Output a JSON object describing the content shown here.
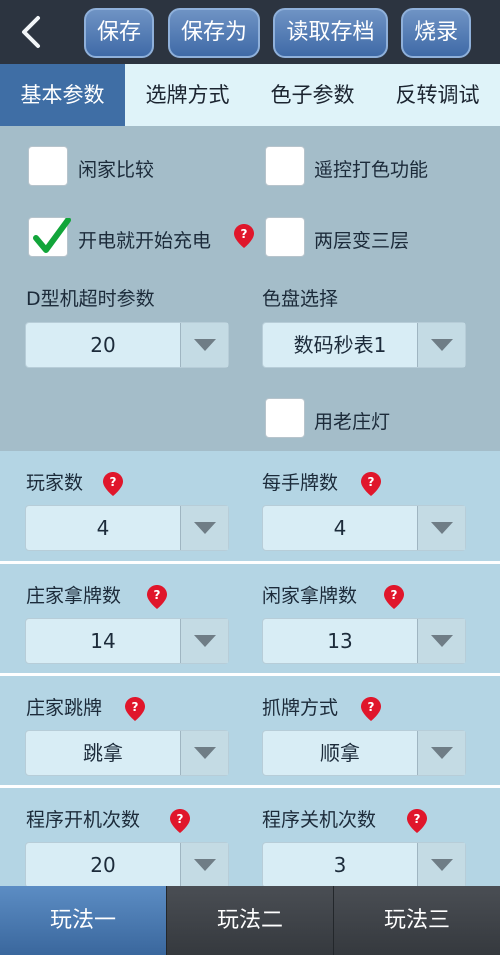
{
  "toolbar": {
    "back_icon": "chevron-left-icon",
    "save": "保存",
    "save_as": "保存为",
    "load": "读取存档",
    "burn": "烧录"
  },
  "tabs": [
    "基本参数",
    "选牌方式",
    "色子参数",
    "反转调试"
  ],
  "active_tab": 0,
  "checkboxes": {
    "idle_compare": {
      "label": "闲家比较",
      "checked": false
    },
    "remote_color": {
      "label": "遥控打色功能",
      "checked": false
    },
    "power_charge": {
      "label": "开电就开始充电",
      "checked": true
    },
    "two_to_three": {
      "label": "两层变三层",
      "checked": false
    },
    "old_dealer_light": {
      "label": "用老庄灯",
      "checked": false
    }
  },
  "fields": {
    "d_timeout": {
      "label": "D型机超时参数",
      "value": "20"
    },
    "dial": {
      "label": "色盘选择",
      "value": "数码秒表1"
    },
    "players": {
      "label": "玩家数",
      "value": "4"
    },
    "cards_per_hand": {
      "label": "每手牌数",
      "value": "4"
    },
    "dealer_take": {
      "label": "庄家拿牌数",
      "value": "14"
    },
    "idle_take": {
      "label": "闲家拿牌数",
      "value": "13"
    },
    "dealer_jump": {
      "label": "庄家跳牌",
      "value": "跳拿"
    },
    "grab_mode": {
      "label": "抓牌方式",
      "value": "顺拿"
    },
    "power_on_count": {
      "label": "程序开机次数",
      "value": "20"
    },
    "power_off_count": {
      "label": "程序关机次数",
      "value": "3"
    }
  },
  "bottom_tabs": [
    "玩法一",
    "玩法二",
    "玩法三"
  ],
  "active_bottom_tab": 0,
  "colors": {
    "accent": "#3f6ea5",
    "help_icon": "#e0162b",
    "check": "#12a53a"
  }
}
